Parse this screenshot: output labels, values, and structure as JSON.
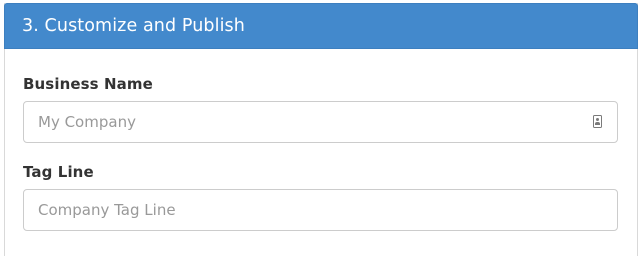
{
  "panel": {
    "title": "3. Customize and Publish"
  },
  "form": {
    "business_name": {
      "label": "Business Name",
      "placeholder": "My Company",
      "value": "",
      "icon": "contact-card-icon"
    },
    "tag_line": {
      "label": "Tag Line",
      "placeholder": "Company Tag Line",
      "value": ""
    }
  },
  "colors": {
    "header_bg": "#4389cc",
    "header_text": "#ffffff",
    "label_text": "#333333",
    "placeholder_text": "#999999",
    "input_border": "#cccccc"
  }
}
